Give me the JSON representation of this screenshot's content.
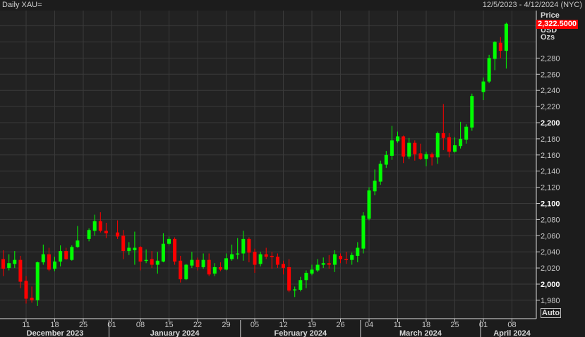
{
  "header": {
    "title": "Daily XAU=",
    "date_range": "12/5/2023 - 4/12/2024 (NYC)"
  },
  "axis": {
    "price_label": "Price",
    "currency_label": "USD",
    "unit_label": "Ozs",
    "last_price": "2,322.5000",
    "auto_button": "Auto"
  },
  "colors": {
    "up": "#00ff00",
    "down": "#ff0000",
    "background": "#222222",
    "grid": "#3a3a3a",
    "last_price_bg": "#ff0000"
  },
  "chart_data": {
    "type": "candlestick",
    "ylim": [
      1970,
      2335
    ],
    "y_ticks": [
      1980,
      2000,
      2020,
      2040,
      2060,
      2080,
      2100,
      2120,
      2140,
      2160,
      2180,
      2200,
      2220,
      2240,
      2260,
      2280
    ],
    "y_tick_labels": [
      "1,980",
      "2,000",
      "2,020",
      "2,040",
      "2,060",
      "2,080",
      "2,100",
      "2,120",
      "2,140",
      "2,160",
      "2,180",
      "2,200",
      "2,220",
      "2,240",
      "2,260",
      "2,280"
    ],
    "x_ticks": [
      {
        "date": "2023-12-11",
        "label": "11"
      },
      {
        "date": "2023-12-18",
        "label": "18"
      },
      {
        "date": "2023-12-25",
        "label": "25"
      },
      {
        "date": "2024-01-01",
        "label": "01"
      },
      {
        "date": "2024-01-08",
        "label": "08"
      },
      {
        "date": "2024-01-15",
        "label": "15"
      },
      {
        "date": "2024-01-22",
        "label": "22"
      },
      {
        "date": "2024-01-29",
        "label": "29"
      },
      {
        "date": "2024-02-05",
        "label": "05"
      },
      {
        "date": "2024-02-12",
        "label": "12"
      },
      {
        "date": "2024-02-19",
        "label": "19"
      },
      {
        "date": "2024-02-26",
        "label": "26"
      },
      {
        "date": "2024-03-04",
        "label": "04"
      },
      {
        "date": "2024-03-11",
        "label": "11"
      },
      {
        "date": "2024-03-18",
        "label": "18"
      },
      {
        "date": "2024-03-25",
        "label": "25"
      },
      {
        "date": "2024-04-01",
        "label": "01"
      },
      {
        "date": "2024-04-08",
        "label": "08"
      }
    ],
    "months": [
      {
        "label": "December 2023",
        "start": "2023-12-01"
      },
      {
        "label": "January 2024",
        "start": "2024-01-01"
      },
      {
        "label": "February 2024",
        "start": "2024-02-01"
      },
      {
        "label": "March 2024",
        "start": "2024-03-01"
      },
      {
        "label": "April 2024",
        "start": "2024-04-01"
      }
    ],
    "columns": [
      "date",
      "open",
      "high",
      "low",
      "close"
    ],
    "candles": [
      [
        "2023-12-05",
        2031,
        2042,
        2010,
        2019
      ],
      [
        "2023-12-06",
        2020,
        2037,
        2017,
        2026
      ],
      [
        "2023-12-07",
        2025,
        2041,
        2020,
        2030
      ],
      [
        "2023-12-08",
        2030,
        2035,
        1995,
        2003
      ],
      [
        "2023-12-11",
        2004,
        2010,
        1976,
        1982
      ],
      [
        "2023-12-12",
        1983,
        1997,
        1977,
        1980
      ],
      [
        "2023-12-13",
        1980,
        2028,
        1973,
        2027
      ],
      [
        "2023-12-14",
        2027,
        2049,
        2024,
        2037
      ],
      [
        "2023-12-15",
        2037,
        2045,
        2016,
        2018
      ],
      [
        "2023-12-18",
        2019,
        2034,
        2016,
        2028
      ],
      [
        "2023-12-19",
        2028,
        2048,
        2022,
        2041
      ],
      [
        "2023-12-20",
        2041,
        2045,
        2030,
        2031
      ],
      [
        "2023-12-21",
        2030,
        2048,
        2029,
        2046
      ],
      [
        "2023-12-22",
        2046,
        2072,
        2045,
        2054
      ],
      [
        "2023-12-26",
        2056,
        2069,
        2053,
        2067
      ],
      [
        "2023-12-27",
        2066,
        2086,
        2060,
        2078
      ],
      [
        "2023-12-28",
        2078,
        2089,
        2064,
        2066
      ],
      [
        "2023-12-29",
        2066,
        2076,
        2057,
        2063
      ],
      [
        "2024-01-02",
        2064,
        2079,
        2056,
        2059
      ],
      [
        "2024-01-03",
        2060,
        2067,
        2031,
        2041
      ],
      [
        "2024-01-04",
        2041,
        2052,
        2036,
        2045
      ],
      [
        "2024-01-05",
        2042,
        2065,
        2024,
        2045
      ],
      [
        "2024-01-08",
        2046,
        2047,
        2017,
        2028
      ],
      [
        "2024-01-09",
        2029,
        2043,
        2026,
        2030
      ],
      [
        "2024-01-10",
        2031,
        2041,
        2020,
        2024
      ],
      [
        "2024-01-11",
        2024,
        2040,
        2013,
        2029
      ],
      [
        "2024-01-12",
        2028,
        2063,
        2027,
        2050
      ],
      [
        "2024-01-15",
        2050,
        2059,
        2048,
        2056
      ],
      [
        "2024-01-16",
        2056,
        2058,
        2024,
        2028
      ],
      [
        "2024-01-17",
        2029,
        2035,
        2002,
        2006
      ],
      [
        "2024-01-18",
        2006,
        2025,
        2005,
        2024
      ],
      [
        "2024-01-19",
        2023,
        2040,
        2020,
        2030
      ],
      [
        "2024-01-22",
        2030,
        2033,
        2017,
        2021
      ],
      [
        "2024-01-23",
        2021,
        2038,
        2019,
        2030
      ],
      [
        "2024-01-24",
        2030,
        2038,
        2010,
        2012
      ],
      [
        "2024-01-25",
        2013,
        2026,
        2010,
        2021
      ],
      [
        "2024-01-26",
        2021,
        2027,
        2016,
        2018
      ],
      [
        "2024-01-29",
        2018,
        2038,
        2017,
        2032
      ],
      [
        "2024-01-30",
        2031,
        2049,
        2029,
        2037
      ],
      [
        "2024-01-31",
        2037,
        2057,
        2031,
        2038
      ],
      [
        "2024-02-01",
        2038,
        2066,
        2029,
        2056
      ],
      [
        "2024-02-02",
        2056,
        2058,
        2027,
        2039
      ],
      [
        "2024-02-05",
        2040,
        2044,
        2014,
        2024
      ],
      [
        "2024-02-06",
        2025,
        2040,
        2022,
        2037
      ],
      [
        "2024-02-07",
        2037,
        2045,
        2031,
        2034
      ],
      [
        "2024-02-08",
        2035,
        2040,
        2019,
        2034
      ],
      [
        "2024-02-09",
        2034,
        2038,
        2020,
        2024
      ],
      [
        "2024-02-12",
        2025,
        2029,
        2012,
        2020
      ],
      [
        "2024-02-13",
        2021,
        2031,
        1990,
        1992
      ],
      [
        "2024-02-14",
        1993,
        1997,
        1984,
        1993.5
      ],
      [
        "2024-02-15",
        1993,
        2009,
        1991,
        2005
      ],
      [
        "2024-02-16",
        2005,
        2017,
        1995,
        2014
      ],
      [
        "2024-02-19",
        2013,
        2024,
        2011,
        2018
      ],
      [
        "2024-02-20",
        2017,
        2031,
        2015,
        2024
      ],
      [
        "2024-02-21",
        2024,
        2033,
        2020,
        2026
      ],
      [
        "2024-02-22",
        2026,
        2036,
        2019,
        2024
      ],
      [
        "2024-02-23",
        2024,
        2042,
        2015,
        2037
      ],
      [
        "2024-02-26",
        2035,
        2038,
        2026,
        2031
      ],
      [
        "2024-02-27",
        2031,
        2040,
        2025,
        2030
      ],
      [
        "2024-02-28",
        2030,
        2039,
        2024,
        2036
      ],
      [
        "2024-02-29",
        2035,
        2052,
        2027,
        2045
      ],
      [
        "2024-03-01",
        2044,
        2089,
        2038,
        2085
      ],
      [
        "2024-03-04",
        2081,
        2120,
        2079,
        2116
      ],
      [
        "2024-03-05",
        2115,
        2142,
        2110,
        2128
      ],
      [
        "2024-03-06",
        2127,
        2153,
        2123,
        2149
      ],
      [
        "2024-03-07",
        2148,
        2165,
        2144,
        2160
      ],
      [
        "2024-03-08",
        2159,
        2196,
        2154,
        2178
      ],
      [
        "2024-03-11",
        2177,
        2189,
        2175,
        2183
      ],
      [
        "2024-03-12",
        2183,
        2184,
        2150,
        2158
      ],
      [
        "2024-03-13",
        2158,
        2181,
        2155,
        2175
      ],
      [
        "2024-03-14",
        2175,
        2178,
        2153,
        2161
      ],
      [
        "2024-03-15",
        2162,
        2174,
        2154,
        2155
      ],
      [
        "2024-03-18",
        2155,
        2164,
        2146,
        2161
      ],
      [
        "2024-03-19",
        2161,
        2163,
        2147,
        2157
      ],
      [
        "2024-03-20",
        2157,
        2189,
        2149,
        2187
      ],
      [
        "2024-03-21",
        2187,
        2223,
        2166,
        2181
      ],
      [
        "2024-03-22",
        2182,
        2187,
        2157,
        2164
      ],
      [
        "2024-03-25",
        2164,
        2182,
        2163,
        2172
      ],
      [
        "2024-03-26",
        2171,
        2201,
        2168,
        2180
      ],
      [
        "2024-03-27",
        2179,
        2198,
        2174,
        2195
      ],
      [
        "2024-03-28",
        2194,
        2236,
        2190,
        2233
      ],
      [
        "2024-04-01",
        2238,
        2256,
        2228,
        2251
      ],
      [
        "2024-04-02",
        2251,
        2284,
        2249,
        2280
      ],
      [
        "2024-04-03",
        2279,
        2301,
        2265,
        2300
      ],
      [
        "2024-04-04",
        2299,
        2306,
        2280,
        2289
      ],
      [
        "2024-04-05",
        2289,
        2324,
        2267,
        2322.5
      ]
    ]
  }
}
